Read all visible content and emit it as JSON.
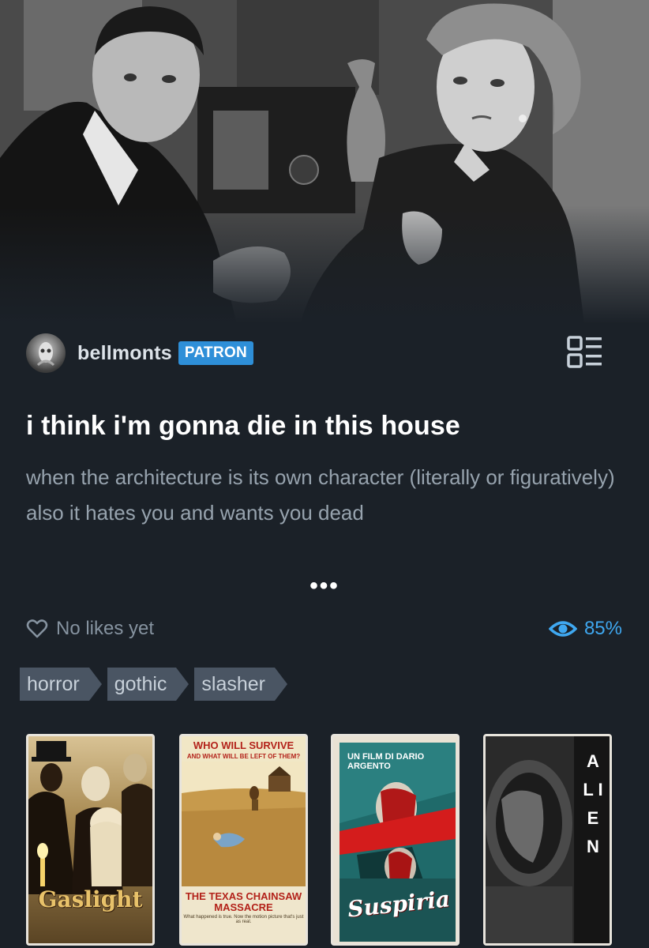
{
  "post": {
    "author": {
      "username": "bellmonts",
      "badge": "PATRON",
      "avatar_icon": "avatar-image"
    },
    "menu_icon": "list-view-icon",
    "title": "i think i'm gonna die in this house",
    "description": "when the architecture is its own character (literally or figuratively) also it hates you and wants you dead",
    "more_label": "•••",
    "likes_label": "No likes yet",
    "views_label": "85%",
    "tags": [
      "horror",
      "gothic",
      "slasher"
    ],
    "posters": [
      {
        "title": "Gaslight"
      },
      {
        "tagline": "WHO WILL SURVIVE",
        "tagline_sub": "AND WHAT WILL BE LEFT OF THEM?",
        "title": "THE TEXAS CHAINSAW MASSACRE",
        "footer": "What happened is true. Now the motion picture that's just as real."
      },
      {
        "director": "UN FILM DI DARIO ARGENTO",
        "title": "Suspiria"
      },
      {
        "title": "A L I E N"
      }
    ]
  },
  "colors": {
    "background": "#1b2128",
    "accent": "#2e8fd8",
    "views": "#3fa8f1",
    "tag_bg": "#4a5563"
  }
}
